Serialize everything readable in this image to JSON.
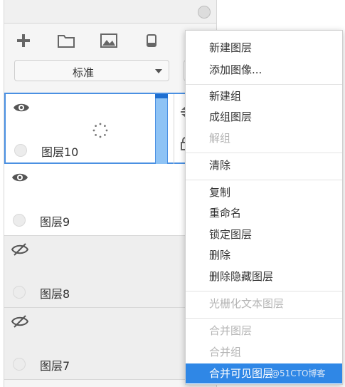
{
  "toolbar": {
    "icons": [
      "add-icon",
      "folder-icon",
      "image-icon",
      "delete-icon"
    ]
  },
  "blend_mode": {
    "value": "标准"
  },
  "layers": [
    {
      "name": "图层10",
      "visible": true,
      "selected": true
    },
    {
      "name": "图层9",
      "visible": true,
      "selected": false
    },
    {
      "name": "图层8",
      "visible": false,
      "selected": false
    },
    {
      "name": "图层7",
      "visible": false,
      "selected": false
    }
  ],
  "menu": {
    "items": [
      {
        "label": "新建图层",
        "enabled": true
      },
      {
        "label": "添加图像...",
        "enabled": true
      },
      {
        "label": "新建组",
        "enabled": true
      },
      {
        "label": "成组图层",
        "enabled": true
      },
      {
        "label": "解组",
        "enabled": false
      },
      {
        "label": "清除",
        "enabled": true
      },
      {
        "label": "复制",
        "enabled": true
      },
      {
        "label": "重命名",
        "enabled": true
      },
      {
        "label": "锁定图层",
        "enabled": true
      },
      {
        "label": "删除",
        "enabled": true
      },
      {
        "label": "删除隐藏图层",
        "enabled": true
      },
      {
        "label": "光栅化文本图层",
        "enabled": false
      },
      {
        "label": "合并图层",
        "enabled": false
      },
      {
        "label": "合并组",
        "enabled": false
      },
      {
        "label": "合并可见图层",
        "enabled": true,
        "highlighted": true
      }
    ],
    "watermark": "@51CTO博客"
  },
  "colors": {
    "accent": "#2f87e6",
    "selection_border": "#4a90e2",
    "disabled_text": "#b5b5b5"
  }
}
